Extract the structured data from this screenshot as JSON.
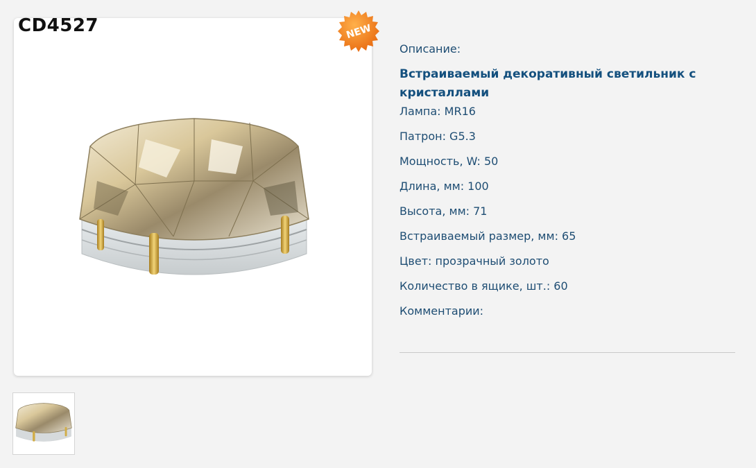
{
  "product": {
    "sku": "CD4527",
    "badge": "NEW",
    "image": "product-photo-crystal-spotlight",
    "thumbnail": "product-thumbnail"
  },
  "specs": {
    "description_label": "Описание:",
    "title": "Встраиваемый декоративный светильник с кристаллами",
    "lamp": "Лампа: MR16",
    "socket": "Патрон: G5.3",
    "power": "Мощность, W: 50",
    "length": "Длина, мм: 100",
    "height": "Высота, мм: 71",
    "cutout": "Встраиваемый размер, мм: 65",
    "color": "Цвет: прозрачный золото",
    "box_qty": "Количество в ящике, шт.: 60",
    "comments": "Комментарии:"
  },
  "colors": {
    "background": "#f3f3f3",
    "text": "#1e4d73",
    "badge": "#f08a1c",
    "sku": "#111111"
  }
}
